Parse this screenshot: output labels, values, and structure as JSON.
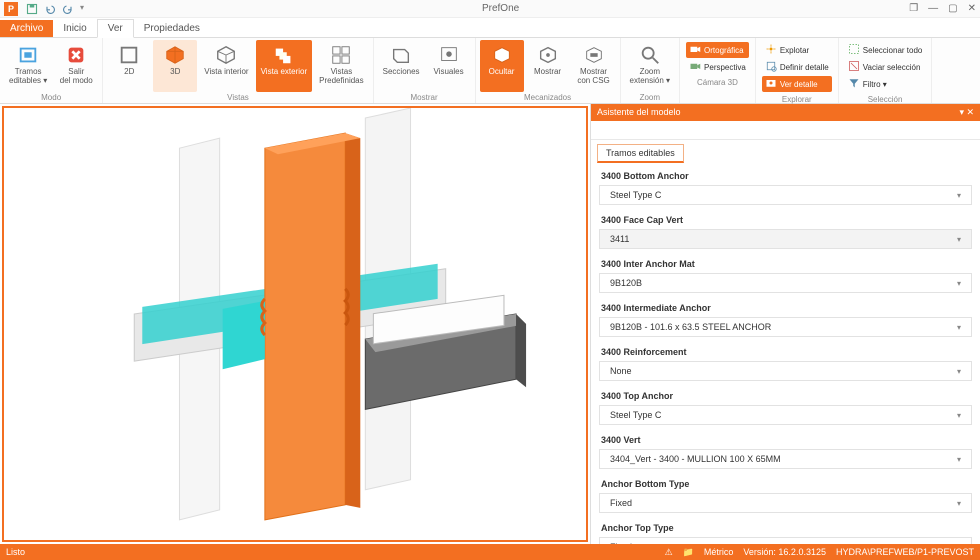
{
  "app": {
    "title": "PrefOne",
    "icon_letter": "P"
  },
  "window_controls": [
    "❐",
    "—",
    "▢",
    "✕"
  ],
  "qat_icons": [
    "save-icon",
    "undo-icon",
    "redo-icon",
    "down-icon"
  ],
  "menu": {
    "file": "Archivo",
    "tabs": [
      "Inicio",
      "Ver",
      "Propiedades"
    ],
    "active": 1
  },
  "ribbon": {
    "groups": [
      {
        "label": "Modo",
        "buttons": [
          {
            "name": "tramos-editables-button",
            "label": "Tramos\neditables ▾",
            "icon": "edit-frame-icon"
          },
          {
            "name": "salir-modo-button",
            "label": "Salir\ndel modo",
            "icon": "exit-icon"
          }
        ]
      },
      {
        "label": "Vistas",
        "buttons": [
          {
            "name": "vista-2d-button",
            "label": "2D",
            "icon": "view-2d-icon"
          },
          {
            "name": "vista-3d-button",
            "label": "3D",
            "icon": "view-3d-icon",
            "selected": "lt"
          },
          {
            "name": "vista-interior-button",
            "label": "Vista interior",
            "icon": "view-interior-icon"
          },
          {
            "name": "vista-exterior-button",
            "label": "Vista exterior",
            "icon": "view-exterior-icon",
            "selected": "sel"
          },
          {
            "name": "vistas-predef-button",
            "label": "Vistas\nPredefinidas",
            "icon": "views-preset-icon"
          }
        ]
      },
      {
        "label": "Mostrar",
        "buttons": [
          {
            "name": "secciones-button",
            "label": "Secciones",
            "icon": "sections-icon"
          },
          {
            "name": "visuales-button",
            "label": "Visuales",
            "icon": "visuals-icon"
          }
        ]
      },
      {
        "label": "Mecanizados",
        "buttons": [
          {
            "name": "ocultar-button",
            "label": "Ocultar",
            "icon": "hide-icon",
            "selected": "sel"
          },
          {
            "name": "mostrar-button",
            "label": "Mostrar",
            "icon": "show-icon"
          },
          {
            "name": "mostrar-csg-button",
            "label": "Mostrar\ncon CSG",
            "icon": "show-csg-icon"
          }
        ]
      },
      {
        "label": "Zoom",
        "buttons": [
          {
            "name": "zoom-ext-button",
            "label": "Zoom\nextensión ▾",
            "icon": "zoom-icon"
          }
        ]
      },
      {
        "label": "Cámara 3D",
        "lines": [
          {
            "name": "ortografica-line",
            "label": "Ortográfica",
            "icon": "camera-icon",
            "sel": true
          },
          {
            "name": "perspectiva-line",
            "label": "Perspectiva",
            "icon": "camera-icon"
          }
        ]
      },
      {
        "label": "Explorar",
        "lines": [
          {
            "name": "explotar-line",
            "label": "Explotar",
            "icon": "explode-icon"
          },
          {
            "name": "definir-detalle-line",
            "label": "Definir detalle",
            "icon": "define-icon"
          },
          {
            "name": "ver-detalle-line",
            "label": "Ver detalle",
            "icon": "detail-icon",
            "sel": true
          }
        ]
      },
      {
        "label": "Selección",
        "lines": [
          {
            "name": "seleccionar-todo-line",
            "label": "Seleccionar todo",
            "icon": "select-all-icon"
          },
          {
            "name": "vaciar-sel-line",
            "label": "Vaciar selección",
            "icon": "clear-sel-icon"
          },
          {
            "name": "filtro-line",
            "label": "Filtro ▾",
            "icon": "filter-icon"
          }
        ]
      }
    ]
  },
  "panel": {
    "title": "Asistente del modelo",
    "tab": "Tramos editables",
    "props": [
      {
        "label": "3400 Bottom Anchor",
        "value": "Steel Type C"
      },
      {
        "label": "3400 Face Cap Vert",
        "value": "3411",
        "hl": true
      },
      {
        "label": "3400 Inter Anchor Mat",
        "value": "9B120B"
      },
      {
        "label": "3400 Intermediate Anchor",
        "value": "9B120B - 101.6 x 63.5 STEEL ANCHOR"
      },
      {
        "label": "3400 Reinforcement",
        "value": "None"
      },
      {
        "label": "3400 Top Anchor",
        "value": "Steel Type C"
      },
      {
        "label": "3400 Vert",
        "value": "3404_Vert - 3400 - MULLION 100 X 65MM"
      },
      {
        "label": "Anchor Bottom Type",
        "value": "Fixed"
      },
      {
        "label": "Anchor Top Type",
        "value": "Fixed"
      }
    ]
  },
  "status": {
    "left": "Listo",
    "metric": "Métrico",
    "version_label": "Versión:",
    "version": "16.2.0.3125",
    "path": "HYDRA\\PREFWEB/P1-PREVOST"
  }
}
